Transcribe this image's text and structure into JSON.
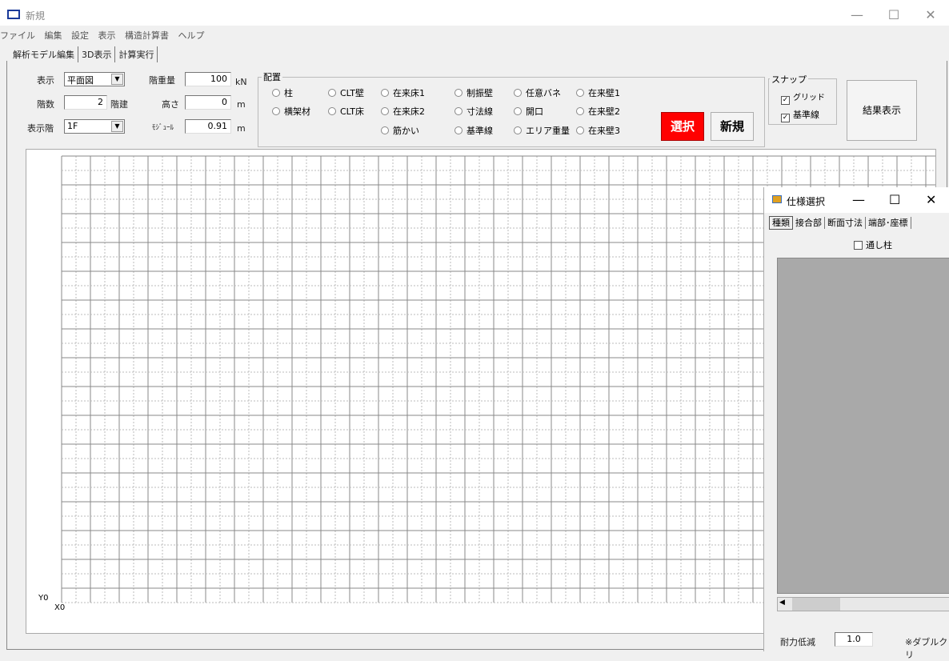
{
  "window": {
    "title": "新規",
    "min": "—",
    "max": "☐",
    "close": "✕"
  },
  "menu": [
    "ファイル",
    "編集",
    "設定",
    "表示",
    "構造計算書",
    "ヘルプ"
  ],
  "tabs": [
    "解析モデル編集",
    "3D表示",
    "計算実行"
  ],
  "form": {
    "display_label": "表示",
    "display_value": "平面図",
    "floors_label": "階数",
    "floors_value": "2",
    "floors_unit": "階建",
    "show_floor_label": "表示階",
    "show_floor_value": "1F",
    "weight_label": "階重量",
    "weight_value": "100",
    "weight_unit": "kN",
    "height_label": "高さ",
    "height_value": "0",
    "height_unit": "m",
    "module_label": "ﾓｼﾞｭｰﾙ",
    "module_value": "0.91",
    "module_unit": "m"
  },
  "placement": {
    "title": "配置",
    "options": [
      "柱",
      "CLT壁",
      "在来床1",
      "制振壁",
      "任意バネ",
      "在来壁1",
      "横架材",
      "CLT床",
      "在来床2",
      "寸法線",
      "開口",
      "在来壁2",
      "筋かい",
      "基準線",
      "エリア重量",
      "在来壁3"
    ]
  },
  "buttons": {
    "select": "選択",
    "new": "新規",
    "result": "結果表示"
  },
  "snap": {
    "title": "スナップ",
    "grid": "グリッド",
    "baseline": "基準線"
  },
  "canvas": {
    "y0": "Y0",
    "x0": "X0"
  },
  "subwindow": {
    "title": "仕様選択",
    "tabs": [
      "種類",
      "接合部",
      "断面寸法",
      "端部･座標"
    ],
    "through_column": "通し柱",
    "reduction_label": "耐力低減",
    "reduction_value": "1.0",
    "note": "※ダブルクリ"
  }
}
